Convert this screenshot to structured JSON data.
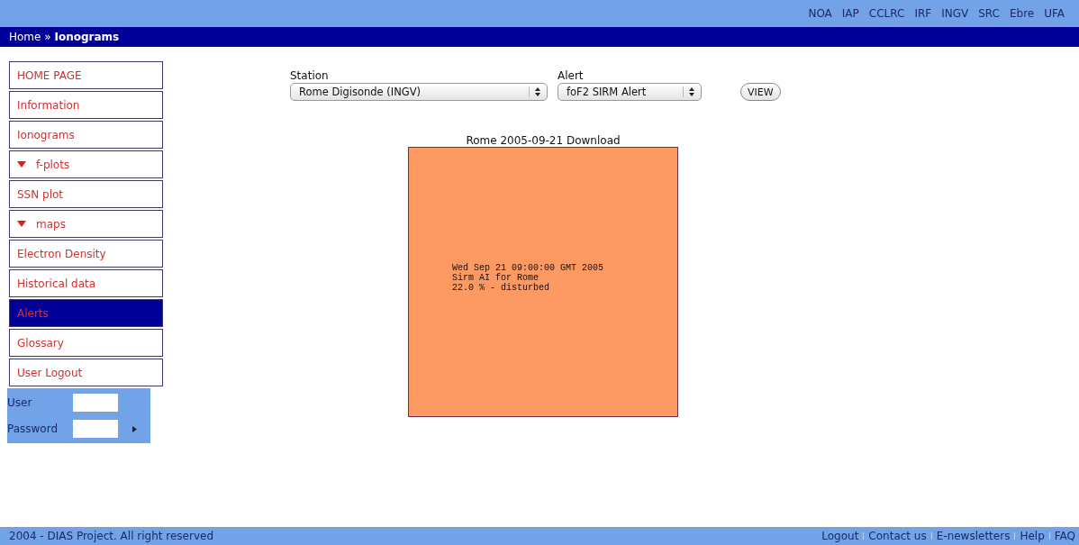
{
  "partner_links": [
    "NOA",
    "IAP",
    "CCLRC",
    "IRF",
    "INGV",
    "SRC",
    "Ebre",
    "UFA"
  ],
  "breadcrumb": "Home » **Ionograms**",
  "sidebar": {
    "items": [
      {
        "label": "HOME PAGE",
        "kind": "link",
        "selected": false
      },
      {
        "label": "Information",
        "kind": "link",
        "selected": false
      },
      {
        "label": "Ionograms",
        "kind": "link",
        "selected": false
      },
      {
        "label": "f-plots",
        "kind": "folder",
        "selected": false
      },
      {
        "label": "SSN plot",
        "kind": "link",
        "selected": false
      },
      {
        "label": "maps",
        "kind": "folder",
        "selected": false
      },
      {
        "label": "Electron Density",
        "kind": "link",
        "selected": false
      },
      {
        "label": "Historical data",
        "kind": "link",
        "selected": false
      },
      {
        "label": "Alerts",
        "kind": "link",
        "selected": true
      },
      {
        "label": "Glossary",
        "kind": "link",
        "selected": false
      },
      {
        "label": "User Logout",
        "kind": "link",
        "selected": false
      }
    ],
    "login": {
      "user_label": "User",
      "password_label": "Password"
    }
  },
  "form": {
    "station": {
      "label": "Station",
      "value": "Rome Digisonde (INGV)"
    },
    "alert": {
      "label": "Alert",
      "value": "foF2 SIRM Alert"
    },
    "button": "VIEW"
  },
  "result": {
    "caption": "Rome 2005-09-21 Download",
    "lines": [
      "Wed Sep 21 09:00:00 GMT 2005",
      "Sirm AI for Rome",
      "22.0 % - disturbed"
    ]
  },
  "footer": {
    "copyright": "2004 - DIAS Project. All right reserved",
    "links": [
      "Logout",
      "Contact us",
      "E-newsletters",
      "Help",
      "FAQ"
    ]
  }
}
